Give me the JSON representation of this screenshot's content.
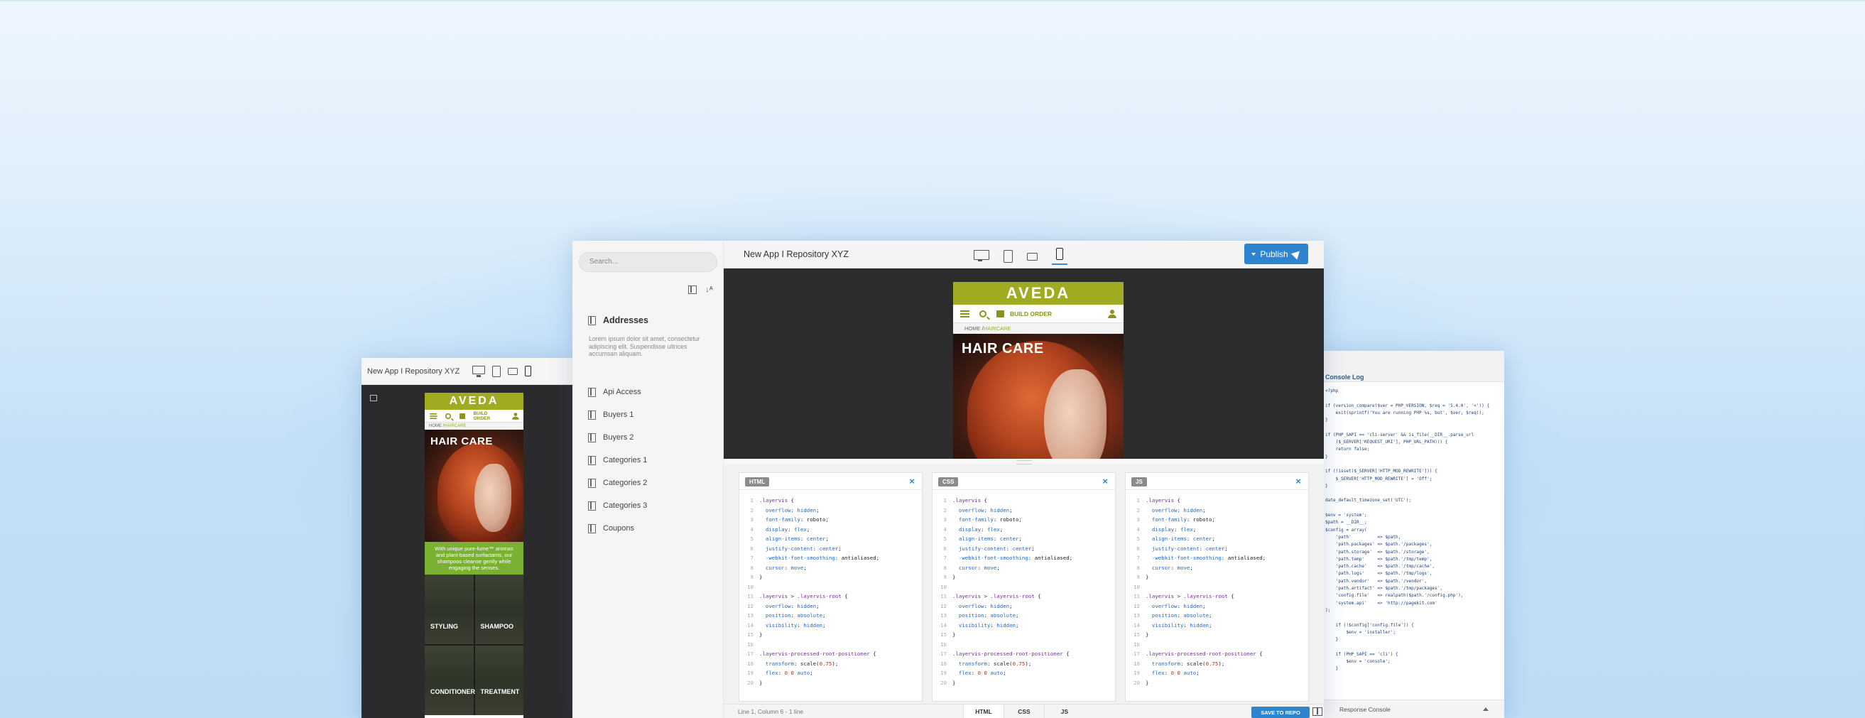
{
  "left_window": {
    "title": "New App I Repository XYZ",
    "icons": [
      "desktop-icon",
      "tablet-icon",
      "tablet-landscape-icon",
      "phone-icon"
    ],
    "site": {
      "brand": "AVEDA",
      "nav_label": "BUILD ORDER",
      "breadcrumb_home": "HOME /",
      "breadcrumb_current": "HAIRCARE",
      "hero_title": "HAIR CARE",
      "promo": "With unique pure-fume™ aromas and plant-based surfactants, our shampoos cleanse gently while engaging the senses.",
      "tiles": [
        "STYLING",
        "SHAMPOO",
        "CONDITIONER",
        "TREATMENT"
      ]
    }
  },
  "main_window": {
    "search_placeholder": "Search...",
    "section_title": "Addresses",
    "section_desc": "Lorem ipsum dolor sit amet, consectetur adipiscing elit. Suspendisse ultrices accumsan aliquam.",
    "items": [
      "Api Access",
      "Buyers 1",
      "Buyers 2",
      "Categories 1",
      "Categories 2",
      "Categories 3",
      "Coupons"
    ],
    "title": "New App I Repository XYZ",
    "publish": "Publish",
    "site": {
      "brand": "AVEDA",
      "nav_label": "BUILD ORDER",
      "breadcrumb_home": "HOME /",
      "breadcrumb_current": "HAIRCARE",
      "hero_title": "HAIR CARE"
    },
    "editors": [
      {
        "tab": "HTML",
        "close": "×"
      },
      {
        "tab": "CSS",
        "close": "×"
      },
      {
        "tab": "JS",
        "close": "×"
      }
    ],
    "status": {
      "position": "Line 1, Column 6 - 1 line",
      "tabs": [
        "HTML",
        "CSS",
        "JS"
      ],
      "save": "SAVE TO REPO"
    }
  },
  "console": {
    "title": "Console Log",
    "code": "<?php\n\nif (version_compare($ver = PHP_VERSION, $req = '5.4.0', '<')) {\n    exit(sprintf('You are running PHP %s, but', $ver, $req));\n}\n\nif (PHP_SAPI == 'cli-server' && is_file(__DIR__.parse_url\n    ($_SERVER['REQUEST_URI'], PHP_URL_PATH))) {\n    return false;\n}\n\nif (!isset($_SERVER['HTTP_MOD_REWRITE'])) {\n    $_SERVER['HTTP_MOD_REWRITE'] = 'Off';\n}\n\ndate_default_timezone_set('UTC');\n\n$env = 'system';\n$path = __DIR__;\n$config = array(\n    'path'          => $path,\n    'path.packages' => $path.'/packages',\n    'path.storage'  => $path.'/storage',\n    'path.temp'     => $path.'/tmp/temp',\n    'path.cache'    => $path.'/tmp/cache',\n    'path.logs'     => $path.'/tmp/logs',\n    'path.vendor'   => $path.'/vendor',\n    'path.artifact' => $path.'/tmp/packages',\n    'config.file'   => realpath($path.'/config.php'),\n    'system.api'    => 'http://pagekit.com'\n);\n\n    if (!$config['config.file']) {\n        $env = 'installer';\n    }\n\n    if (PHP_SAPI == 'cli') {\n        $env = 'console';\n    }",
    "response": "Response Console"
  }
}
